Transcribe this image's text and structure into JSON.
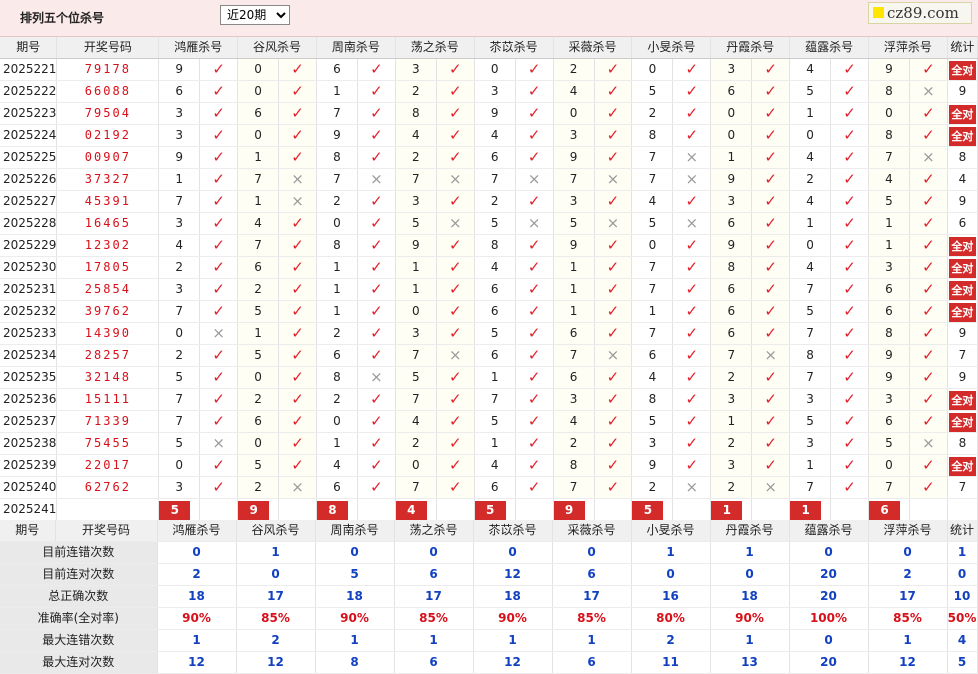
{
  "header": {
    "title": "排列五个位杀号",
    "period_selected": "近20期",
    "logo_text": "cz89.com"
  },
  "columns": {
    "issue": "期号",
    "draw": "开奖号码",
    "experts": [
      "鸿雁杀号",
      "谷风杀号",
      "周南杀号",
      "荡之杀号",
      "苶苡杀号",
      "采薇杀号",
      "小旻杀号",
      "丹霞杀号",
      "蕴露杀号",
      "浮萍杀号"
    ],
    "stat": "统计"
  },
  "rows": [
    {
      "issue": "2025221",
      "draw": "79178",
      "picks": [
        [
          9,
          1
        ],
        [
          0,
          1
        ],
        [
          6,
          1
        ],
        [
          3,
          1
        ],
        [
          0,
          1
        ],
        [
          2,
          1
        ],
        [
          0,
          1
        ],
        [
          3,
          1
        ],
        [
          4,
          1
        ],
        [
          9,
          1
        ]
      ],
      "stat": "全对"
    },
    {
      "issue": "2025222",
      "draw": "66088",
      "picks": [
        [
          6,
          1
        ],
        [
          0,
          1
        ],
        [
          1,
          1
        ],
        [
          2,
          1
        ],
        [
          3,
          1
        ],
        [
          4,
          1
        ],
        [
          5,
          1
        ],
        [
          6,
          1
        ],
        [
          5,
          1
        ],
        [
          8,
          0
        ]
      ],
      "stat": "9"
    },
    {
      "issue": "2025223",
      "draw": "79504",
      "picks": [
        [
          3,
          1
        ],
        [
          6,
          1
        ],
        [
          7,
          1
        ],
        [
          8,
          1
        ],
        [
          9,
          1
        ],
        [
          0,
          1
        ],
        [
          2,
          1
        ],
        [
          0,
          1
        ],
        [
          1,
          1
        ],
        [
          0,
          1
        ]
      ],
      "stat": "全对"
    },
    {
      "issue": "2025224",
      "draw": "02192",
      "picks": [
        [
          3,
          1
        ],
        [
          0,
          1
        ],
        [
          9,
          1
        ],
        [
          4,
          1
        ],
        [
          4,
          1
        ],
        [
          3,
          1
        ],
        [
          8,
          1
        ],
        [
          0,
          1
        ],
        [
          0,
          1
        ],
        [
          8,
          1
        ]
      ],
      "stat": "全对"
    },
    {
      "issue": "2025225",
      "draw": "00907",
      "picks": [
        [
          9,
          1
        ],
        [
          1,
          1
        ],
        [
          8,
          1
        ],
        [
          2,
          1
        ],
        [
          6,
          1
        ],
        [
          9,
          1
        ],
        [
          7,
          0
        ],
        [
          1,
          1
        ],
        [
          4,
          1
        ],
        [
          7,
          0
        ]
      ],
      "stat": "8"
    },
    {
      "issue": "2025226",
      "draw": "37327",
      "picks": [
        [
          1,
          1
        ],
        [
          7,
          0
        ],
        [
          7,
          0
        ],
        [
          7,
          0
        ],
        [
          7,
          0
        ],
        [
          7,
          0
        ],
        [
          7,
          0
        ],
        [
          9,
          1
        ],
        [
          2,
          1
        ],
        [
          4,
          1
        ]
      ],
      "stat": "4"
    },
    {
      "issue": "2025227",
      "draw": "45391",
      "picks": [
        [
          7,
          1
        ],
        [
          1,
          0
        ],
        [
          2,
          1
        ],
        [
          3,
          1
        ],
        [
          2,
          1
        ],
        [
          3,
          1
        ],
        [
          4,
          1
        ],
        [
          3,
          1
        ],
        [
          4,
          1
        ],
        [
          5,
          1
        ]
      ],
      "stat": "9"
    },
    {
      "issue": "2025228",
      "draw": "16465",
      "picks": [
        [
          3,
          1
        ],
        [
          4,
          1
        ],
        [
          0,
          1
        ],
        [
          5,
          0
        ],
        [
          5,
          0
        ],
        [
          5,
          0
        ],
        [
          5,
          0
        ],
        [
          6,
          1
        ],
        [
          1,
          1
        ],
        [
          1,
          1
        ]
      ],
      "stat": "6"
    },
    {
      "issue": "2025229",
      "draw": "12302",
      "picks": [
        [
          4,
          1
        ],
        [
          7,
          1
        ],
        [
          8,
          1
        ],
        [
          9,
          1
        ],
        [
          8,
          1
        ],
        [
          9,
          1
        ],
        [
          0,
          1
        ],
        [
          9,
          1
        ],
        [
          0,
          1
        ],
        [
          1,
          1
        ]
      ],
      "stat": "全对"
    },
    {
      "issue": "2025230",
      "draw": "17805",
      "picks": [
        [
          2,
          1
        ],
        [
          6,
          1
        ],
        [
          1,
          1
        ],
        [
          1,
          1
        ],
        [
          4,
          1
        ],
        [
          1,
          1
        ],
        [
          7,
          1
        ],
        [
          8,
          1
        ],
        [
          4,
          1
        ],
        [
          3,
          1
        ]
      ],
      "stat": "全对"
    },
    {
      "issue": "2025231",
      "draw": "25854",
      "picks": [
        [
          3,
          1
        ],
        [
          2,
          1
        ],
        [
          1,
          1
        ],
        [
          1,
          1
        ],
        [
          6,
          1
        ],
        [
          1,
          1
        ],
        [
          7,
          1
        ],
        [
          6,
          1
        ],
        [
          7,
          1
        ],
        [
          6,
          1
        ]
      ],
      "stat": "全对"
    },
    {
      "issue": "2025232",
      "draw": "39762",
      "picks": [
        [
          7,
          1
        ],
        [
          5,
          1
        ],
        [
          1,
          1
        ],
        [
          0,
          1
        ],
        [
          6,
          1
        ],
        [
          1,
          1
        ],
        [
          1,
          1
        ],
        [
          6,
          1
        ],
        [
          5,
          1
        ],
        [
          6,
          1
        ]
      ],
      "stat": "全对"
    },
    {
      "issue": "2025233",
      "draw": "14390",
      "picks": [
        [
          0,
          0
        ],
        [
          1,
          1
        ],
        [
          2,
          1
        ],
        [
          3,
          1
        ],
        [
          5,
          1
        ],
        [
          6,
          1
        ],
        [
          7,
          1
        ],
        [
          6,
          1
        ],
        [
          7,
          1
        ],
        [
          8,
          1
        ]
      ],
      "stat": "9"
    },
    {
      "issue": "2025234",
      "draw": "28257",
      "picks": [
        [
          2,
          1
        ],
        [
          5,
          1
        ],
        [
          6,
          1
        ],
        [
          7,
          0
        ],
        [
          6,
          1
        ],
        [
          7,
          0
        ],
        [
          6,
          1
        ],
        [
          7,
          0
        ],
        [
          8,
          1
        ],
        [
          9,
          1
        ]
      ],
      "stat": "7"
    },
    {
      "issue": "2025235",
      "draw": "32148",
      "picks": [
        [
          5,
          1
        ],
        [
          0,
          1
        ],
        [
          8,
          0
        ],
        [
          5,
          1
        ],
        [
          1,
          1
        ],
        [
          6,
          1
        ],
        [
          4,
          1
        ],
        [
          2,
          1
        ],
        [
          7,
          1
        ],
        [
          9,
          1
        ]
      ],
      "stat": "9"
    },
    {
      "issue": "2025236",
      "draw": "15111",
      "picks": [
        [
          7,
          1
        ],
        [
          2,
          1
        ],
        [
          2,
          1
        ],
        [
          7,
          1
        ],
        [
          7,
          1
        ],
        [
          3,
          1
        ],
        [
          8,
          1
        ],
        [
          3,
          1
        ],
        [
          3,
          1
        ],
        [
          3,
          1
        ]
      ],
      "stat": "全对"
    },
    {
      "issue": "2025237",
      "draw": "71339",
      "picks": [
        [
          7,
          1
        ],
        [
          6,
          1
        ],
        [
          0,
          1
        ],
        [
          4,
          1
        ],
        [
          5,
          1
        ],
        [
          4,
          1
        ],
        [
          5,
          1
        ],
        [
          1,
          1
        ],
        [
          5,
          1
        ],
        [
          6,
          1
        ]
      ],
      "stat": "全对"
    },
    {
      "issue": "2025238",
      "draw": "75455",
      "picks": [
        [
          5,
          0
        ],
        [
          0,
          1
        ],
        [
          1,
          1
        ],
        [
          2,
          1
        ],
        [
          1,
          1
        ],
        [
          2,
          1
        ],
        [
          3,
          1
        ],
        [
          2,
          1
        ],
        [
          3,
          1
        ],
        [
          5,
          0
        ]
      ],
      "stat": "8"
    },
    {
      "issue": "2025239",
      "draw": "22017",
      "picks": [
        [
          0,
          1
        ],
        [
          5,
          1
        ],
        [
          4,
          1
        ],
        [
          0,
          1
        ],
        [
          4,
          1
        ],
        [
          8,
          1
        ],
        [
          9,
          1
        ],
        [
          3,
          1
        ],
        [
          1,
          1
        ],
        [
          0,
          1
        ]
      ],
      "stat": "全对"
    },
    {
      "issue": "2025240",
      "draw": "62762",
      "picks": [
        [
          3,
          1
        ],
        [
          2,
          0
        ],
        [
          6,
          1
        ],
        [
          7,
          1
        ],
        [
          6,
          1
        ],
        [
          7,
          1
        ],
        [
          2,
          0
        ],
        [
          2,
          0
        ],
        [
          7,
          1
        ],
        [
          7,
          1
        ]
      ],
      "stat": "7"
    }
  ],
  "current": {
    "issue": "2025241",
    "label": "当前期杀号",
    "picks": [
      5,
      9,
      8,
      4,
      5,
      9,
      5,
      1,
      1,
      6
    ]
  },
  "stats": {
    "header_issue": "期号",
    "header_draw": "开奖号码",
    "rows": [
      {
        "label": "目前连错次数",
        "values": [
          "0",
          "1",
          "0",
          "0",
          "0",
          "0",
          "1",
          "1",
          "0",
          "0",
          "1"
        ]
      },
      {
        "label": "目前连对次数",
        "values": [
          "2",
          "0",
          "5",
          "6",
          "12",
          "6",
          "0",
          "0",
          "20",
          "2",
          "0"
        ]
      },
      {
        "label": "总正确次数",
        "values": [
          "18",
          "17",
          "18",
          "17",
          "18",
          "17",
          "16",
          "18",
          "20",
          "17",
          "10"
        ]
      },
      {
        "label": "准确率(全对率)",
        "values": [
          "90%",
          "85%",
          "90%",
          "85%",
          "90%",
          "85%",
          "80%",
          "90%",
          "100%",
          "85%",
          "50%"
        ]
      },
      {
        "label": "最大连错次数",
        "values": [
          "1",
          "2",
          "1",
          "1",
          "1",
          "1",
          "2",
          "1",
          "0",
          "1",
          "4"
        ]
      },
      {
        "label": "最大连对次数",
        "values": [
          "12",
          "12",
          "8",
          "6",
          "12",
          "6",
          "11",
          "13",
          "20",
          "12",
          "5"
        ]
      }
    ]
  },
  "icons": {
    "check": "check-icon",
    "cross": "cross-icon"
  },
  "colors": {
    "accent": "#d32a2a",
    "hit": "#e2202a",
    "miss": "#999999",
    "stat_blue": "#1140c0"
  }
}
